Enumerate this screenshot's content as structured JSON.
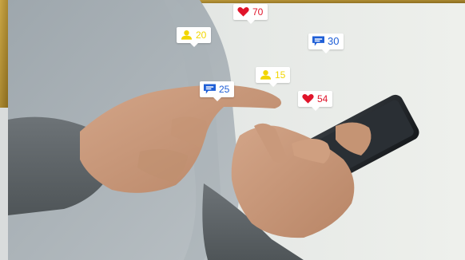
{
  "colors": {
    "heart": "#e0142a",
    "user": "#f2d600",
    "comment": "#1f5fd6",
    "frame_gold": "#b08d2c"
  },
  "notifications": [
    {
      "icon": "heart-icon",
      "count": "70"
    },
    {
      "icon": "user-icon",
      "count": "20"
    },
    {
      "icon": "comment-icon",
      "count": "30"
    },
    {
      "icon": "user-icon",
      "count": "15"
    },
    {
      "icon": "comment-icon",
      "count": "25"
    },
    {
      "icon": "heart-icon",
      "count": "54"
    }
  ]
}
